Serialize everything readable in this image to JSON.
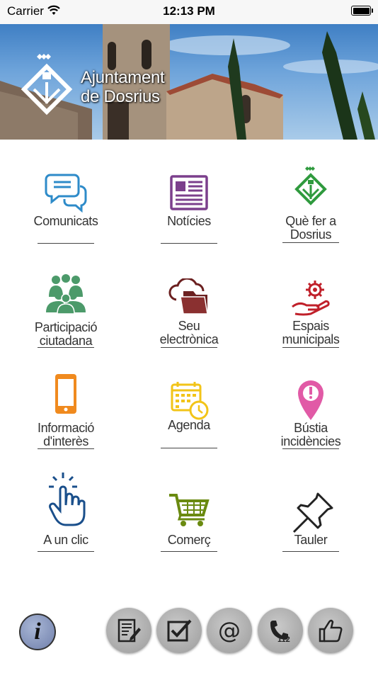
{
  "status_bar": {
    "carrier": "Carrier",
    "time": "12:13 PM"
  },
  "banner": {
    "title_line1": "Ajuntament",
    "title_line2": "de Dosrius"
  },
  "tiles": [
    {
      "label_line1": "Comunicats",
      "label_line2": "",
      "icon": "chat-bubbles-icon",
      "color": "#2e8bc9"
    },
    {
      "label_line1": "Notícies",
      "label_line2": "",
      "icon": "newspaper-icon",
      "color": "#7b3f8c"
    },
    {
      "label_line1": "Què fer a",
      "label_line2": "Dosrius",
      "icon": "dosrius-logo-icon",
      "color": "#2f9a3e"
    },
    {
      "label_line1": "Participació",
      "label_line2": "ciutadana",
      "icon": "people-group-icon",
      "color": "#4c9a6a"
    },
    {
      "label_line1": "Seu",
      "label_line2": "electrònica",
      "icon": "cloud-folder-icon",
      "color": "#6b2020"
    },
    {
      "label_line1": "Espais",
      "label_line2": "municipals",
      "icon": "gear-hand-icon",
      "color": "#c0202a"
    },
    {
      "label_line1": "Informació",
      "label_line2": "d'interès",
      "icon": "smartphone-icon",
      "color": "#f08a1e"
    },
    {
      "label_line1": "Agenda",
      "label_line2": "",
      "icon": "calendar-clock-icon",
      "color": "#f2c418"
    },
    {
      "label_line1": "Bústia",
      "label_line2": "incidències",
      "icon": "map-pin-icon",
      "color": "#e15aa6"
    },
    {
      "label_line1": "A un clic",
      "label_line2": "",
      "icon": "hand-click-icon",
      "color": "#1a4f8b"
    },
    {
      "label_line1": "Comerç",
      "label_line2": "",
      "icon": "shopping-cart-icon",
      "color": "#6a8a10"
    },
    {
      "label_line1": "Tauler",
      "label_line2": "",
      "icon": "pushpin-icon",
      "color": "#222222"
    }
  ],
  "bottom_bar": {
    "info_label": "i",
    "buttons": [
      "form-edit-icon",
      "checkbox-icon",
      "at-sign-icon",
      "phone-112-icon",
      "thumbs-up-icon"
    ],
    "at_label": "@",
    "phone_number": "112"
  }
}
